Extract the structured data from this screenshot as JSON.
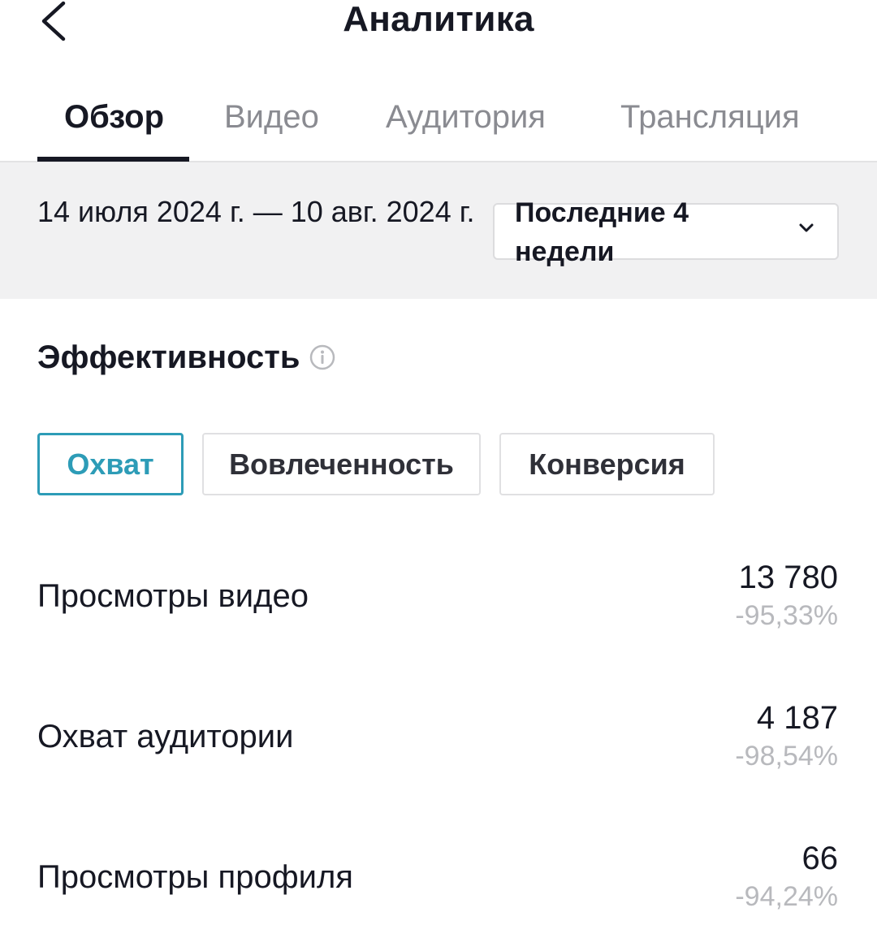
{
  "header": {
    "title": "Аналитика"
  },
  "tabs": [
    {
      "label": "Обзор",
      "active": true
    },
    {
      "label": "Видео",
      "active": false
    },
    {
      "label": "Аудитория",
      "active": false
    },
    {
      "label": "Трансляция",
      "active": false
    }
  ],
  "date_filter": {
    "range": "14 июля 2024 г. — 10 авг. 2024 г.",
    "period": "Последние 4 недели"
  },
  "section": {
    "title": "Эффективность"
  },
  "segments": [
    {
      "label": "Охват",
      "active": true
    },
    {
      "label": "Вовлеченность",
      "active": false
    },
    {
      "label": "Конверсия",
      "active": false
    }
  ],
  "metrics": [
    {
      "label": "Просмотры видео",
      "value": "13 780",
      "delta": "-95,33%"
    },
    {
      "label": "Охват аудитории",
      "value": "4 187",
      "delta": "-98,54%"
    },
    {
      "label": "Просмотры профиля",
      "value": "66",
      "delta": "-94,24%"
    }
  ],
  "colors": {
    "accent": "#2d9cb7",
    "text": "#161823",
    "muted": "#8a8b91",
    "band": "#f1f1f2"
  }
}
